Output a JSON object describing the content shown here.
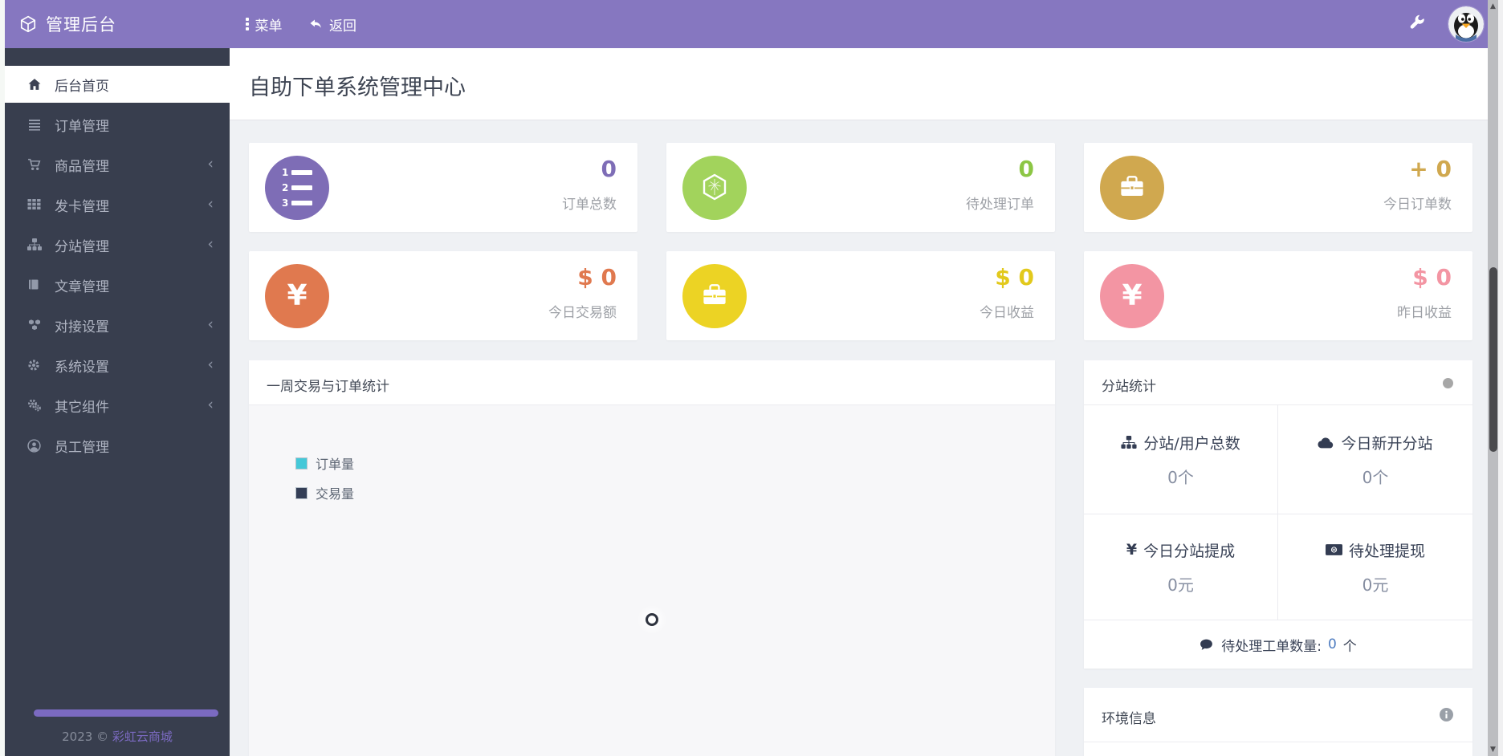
{
  "topbar": {
    "brand": "管理后台",
    "menu_label": "菜单",
    "back_label": "返回"
  },
  "sidebar": {
    "chevron": "‹",
    "items": [
      {
        "label": "后台首页",
        "icon": "home-icon",
        "active": true
      },
      {
        "label": "订单管理",
        "icon": "list-icon"
      },
      {
        "label": "商品管理",
        "icon": "cart-icon",
        "has_children": true
      },
      {
        "label": "发卡管理",
        "icon": "grid-icon",
        "has_children": true
      },
      {
        "label": "分站管理",
        "icon": "sitemap-icon",
        "has_children": true
      },
      {
        "label": "文章管理",
        "icon": "book-icon"
      },
      {
        "label": "对接设置",
        "icon": "cubes-icon",
        "has_children": true
      },
      {
        "label": "系统设置",
        "icon": "gear-icon",
        "has_children": true
      },
      {
        "label": "其它组件",
        "icon": "gears-icon",
        "has_children": true
      },
      {
        "label": "员工管理",
        "icon": "user-icon"
      }
    ],
    "copyright_prefix": "2023 ©",
    "copyright_brand": "彩虹云商城"
  },
  "page": {
    "title": "自助下单系统管理中心"
  },
  "stat_cards": [
    {
      "label": "订单总数",
      "value": "0",
      "icon": "ordered-list-icon",
      "circle_color": "#7e6db6",
      "value_color": "#7e6db6",
      "ol_digits": [
        "1",
        "2",
        "3"
      ]
    },
    {
      "label": "待处理订单",
      "value": "0",
      "icon": "cube-icon",
      "circle_color": "#a2d35c",
      "value_color": "#8cc644"
    },
    {
      "label": "今日订单数",
      "value": "+ 0",
      "icon": "briefcase-icon",
      "circle_color": "#d0a84f",
      "value_color": "#d0a84f"
    },
    {
      "label": "今日交易额",
      "value": "$ 0",
      "icon": "yen-icon",
      "circle_color": "#e0794f",
      "value_color": "#e0794f",
      "glyph": "¥"
    },
    {
      "label": "今日收益",
      "value": "$ 0",
      "icon": "briefcase-icon",
      "circle_color": "#ecd324",
      "value_color": "#e2c91c"
    },
    {
      "label": "昨日收益",
      "value": "$ 0",
      "icon": "yen-icon",
      "circle_color": "#f395a3",
      "value_color": "#f395a3",
      "glyph": "¥"
    }
  ],
  "chart_panel": {
    "title": "一周交易与订单统计",
    "state": "loading",
    "legend": [
      {
        "label": "订单量",
        "color": "#45c8d8"
      },
      {
        "label": "交易量",
        "color": "#343e56"
      }
    ]
  },
  "branch_panel": {
    "title": "分站统计",
    "cells": [
      {
        "icon": "sitemap-icon",
        "label": "分站/用户总数",
        "value": "0个"
      },
      {
        "icon": "cloud-icon",
        "label": "今日新开分站",
        "value": "0个"
      },
      {
        "icon": "yen-icon",
        "label": "今日分站提成",
        "value": "0元",
        "glyph": "¥"
      },
      {
        "icon": "money-bill-icon",
        "label": "待处理提现",
        "value": "0元"
      }
    ],
    "footer_label": "待处理工单数量:",
    "footer_value": "0",
    "footer_suffix": "个"
  },
  "env_panel": {
    "title": "环境信息"
  },
  "scrollbar": {
    "up_glyph": "▲",
    "down_glyph": "▼"
  },
  "theme_colors": {
    "topbar": "#8677c0",
    "sidebar": "#383e4e",
    "accent": "#7b6ac1",
    "content_bg": "#eff1f4"
  }
}
